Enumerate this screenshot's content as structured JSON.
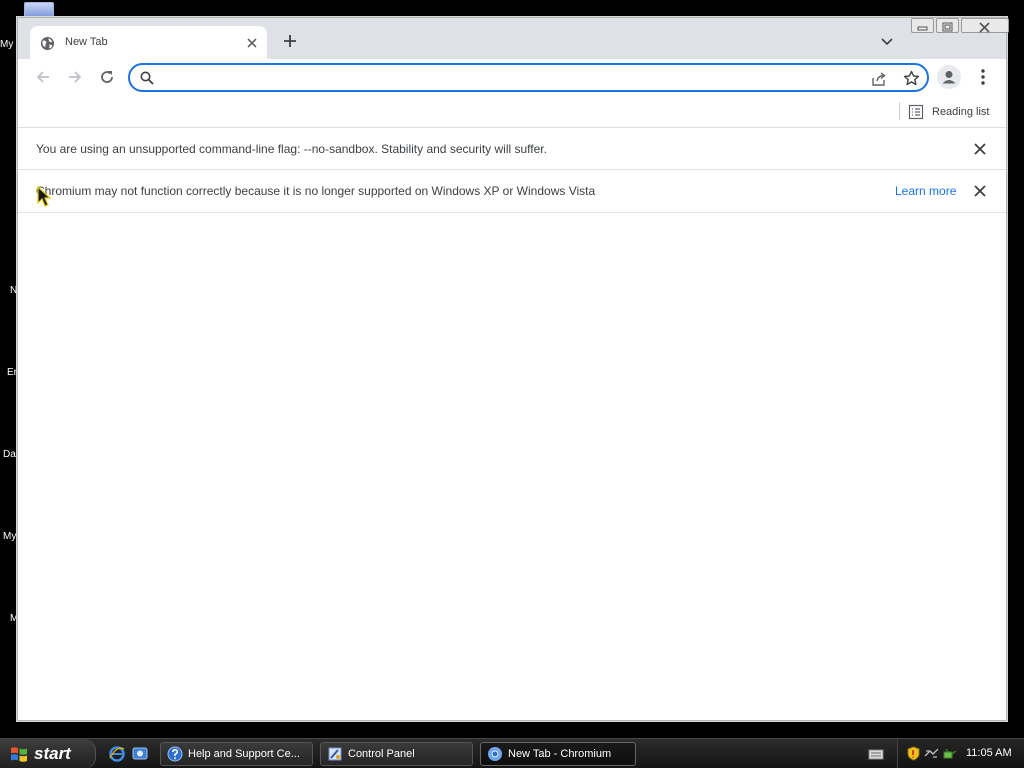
{
  "desktop": {
    "icon_labels": [
      "My",
      "N",
      "En",
      "Da",
      "My",
      "M"
    ]
  },
  "browser": {
    "tab": {
      "title": "New Tab"
    },
    "omnibox": {
      "value": "",
      "placeholder": ""
    },
    "bookmarks_bar": {
      "reading_list_label": "Reading list"
    },
    "infobars": [
      {
        "text": "You are using an unsupported command-line flag: --no-sandbox. Stability and security will suffer."
      },
      {
        "text": "Chromium may not function correctly because it is no longer supported on Windows XP or Windows Vista",
        "link": "Learn more"
      }
    ],
    "accent_color": "#1a73e8"
  },
  "taskbar": {
    "start_label": "start",
    "tasks": [
      {
        "label": "Help and Support Ce..."
      },
      {
        "label": "Control Panel"
      },
      {
        "label": "New Tab - Chromium"
      }
    ],
    "clock": "11:05 AM"
  }
}
